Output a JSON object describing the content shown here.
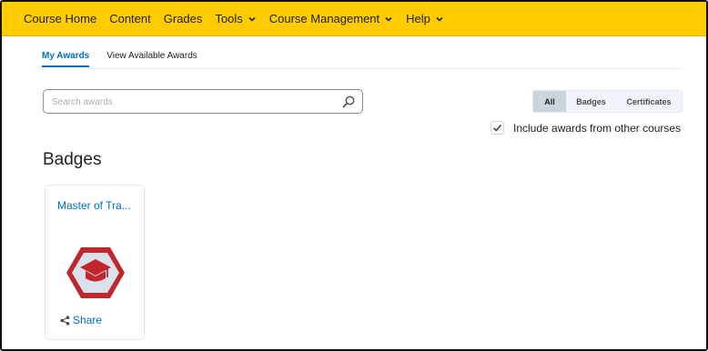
{
  "nav": {
    "items": [
      {
        "label": "Course Home",
        "has_menu": false
      },
      {
        "label": "Content",
        "has_menu": false
      },
      {
        "label": "Grades",
        "has_menu": false
      },
      {
        "label": "Tools",
        "has_menu": true
      },
      {
        "label": "Course Management",
        "has_menu": true
      },
      {
        "label": "Help",
        "has_menu": true
      }
    ],
    "background_color": "#ffcc00"
  },
  "tabs": [
    {
      "label": "My Awards",
      "active": true
    },
    {
      "label": "View Available Awards",
      "active": false
    }
  ],
  "search": {
    "placeholder": "Search awards",
    "value": ""
  },
  "filters": {
    "options": [
      "All",
      "Badges",
      "Certificates"
    ],
    "selected": "All"
  },
  "include_other": {
    "label": "Include awards from other courses",
    "checked": true
  },
  "section": {
    "heading": "Badges"
  },
  "cards": [
    {
      "title": "Master of Tra...",
      "icon": "graduation-cap-hexagon-badge",
      "badge_color": "#c0272d",
      "share_label": "Share"
    }
  ],
  "colors": {
    "accent": "#006fbf",
    "text": "#202122"
  }
}
